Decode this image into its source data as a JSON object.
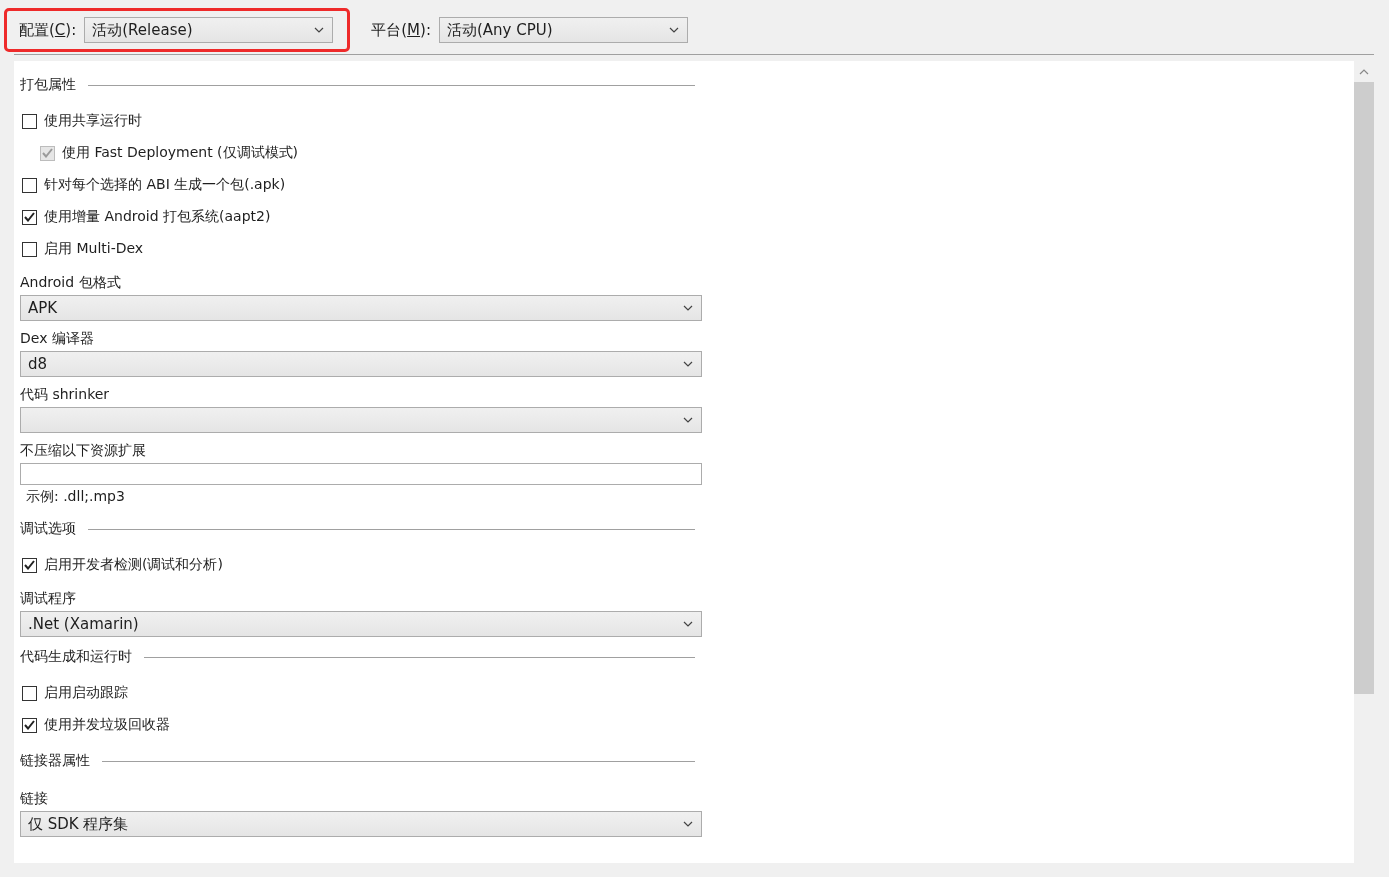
{
  "toolbar": [
    {
      "label_before": "配置(",
      "access_key": "C",
      "label_after": "):",
      "value": "活动(Release)",
      "highlighted": true
    },
    {
      "label_before": "平台(",
      "access_key": "M",
      "label_after": "):",
      "value": "活动(Any CPU)",
      "highlighted": false
    }
  ],
  "form": [
    {
      "kind": "section",
      "label": "打包属性"
    },
    {
      "kind": "checkbox",
      "label": "使用共享运行时",
      "checked": false,
      "disabled": false,
      "children": [
        {
          "kind": "checkbox",
          "label": "使用 Fast Deployment (仅调试模式)",
          "checked": true,
          "disabled": true
        }
      ]
    },
    {
      "kind": "checkbox",
      "label": "针对每个选择的 ABI 生成一个包(.apk)",
      "checked": false,
      "disabled": false
    },
    {
      "kind": "checkbox",
      "label": "使用增量 Android 打包系统(aapt2)",
      "checked": true,
      "disabled": false
    },
    {
      "kind": "checkbox",
      "label": "启用 Multi-Dex",
      "checked": false,
      "disabled": false
    },
    {
      "kind": "label",
      "label": "Android 包格式"
    },
    {
      "kind": "select",
      "value": "APK"
    },
    {
      "kind": "label",
      "label": "Dex 编译器"
    },
    {
      "kind": "select",
      "value": "d8"
    },
    {
      "kind": "label",
      "label": "代码 shrinker"
    },
    {
      "kind": "select"
    },
    {
      "kind": "label",
      "label": "不压缩以下资源扩展"
    },
    {
      "kind": "input"
    },
    {
      "kind": "hint",
      "label": "示例: .dll;.mp3"
    },
    {
      "kind": "section",
      "label": "调试选项"
    },
    {
      "kind": "checkbox",
      "label": "启用开发者检测(调试和分析)",
      "checked": true,
      "disabled": false
    },
    {
      "kind": "label",
      "label": "调试程序"
    },
    {
      "kind": "select",
      "value": ".Net (Xamarin)"
    },
    {
      "kind": "section",
      "label": "代码生成和运行时"
    },
    {
      "kind": "checkbox",
      "label": "启用启动跟踪",
      "checked": false,
      "disabled": false
    },
    {
      "kind": "checkbox",
      "label": "使用并发垃圾回收器",
      "checked": true,
      "disabled": false
    },
    {
      "kind": "section",
      "label": "链接器属性"
    },
    {
      "kind": "label",
      "label": "链接"
    },
    {
      "kind": "select",
      "value": "仅 SDK 程序集"
    }
  ]
}
